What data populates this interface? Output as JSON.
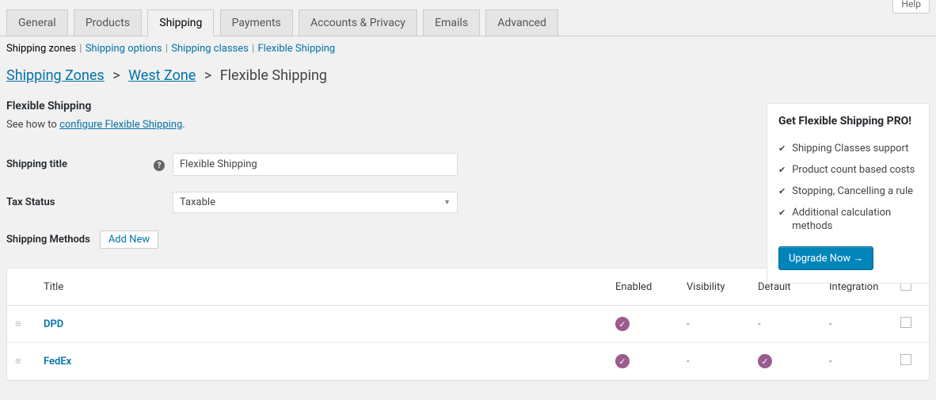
{
  "help_button": "Help",
  "tabs": [
    {
      "label": "General",
      "active": false
    },
    {
      "label": "Products",
      "active": false
    },
    {
      "label": "Shipping",
      "active": true
    },
    {
      "label": "Payments",
      "active": false
    },
    {
      "label": "Accounts & Privacy",
      "active": false
    },
    {
      "label": "Emails",
      "active": false
    },
    {
      "label": "Advanced",
      "active": false
    }
  ],
  "subtabs": {
    "current": "Shipping zones",
    "items": [
      "Shipping options",
      "Shipping classes",
      "Flexible Shipping"
    ]
  },
  "breadcrumb": {
    "items": [
      {
        "label": "Shipping Zones",
        "link": true
      },
      {
        "label": "West Zone",
        "link": true
      },
      {
        "label": "Flexible Shipping",
        "link": false
      }
    ]
  },
  "section_title": "Flexible Shipping",
  "configure": {
    "prefix": "See how to ",
    "link": "configure Flexible Shipping",
    "suffix": "."
  },
  "fields": {
    "shipping_title": {
      "label": "Shipping title",
      "value": "Flexible Shipping"
    },
    "tax_status": {
      "label": "Tax Status",
      "value": "Taxable"
    }
  },
  "methods_header": {
    "label": "Shipping Methods",
    "add_new": "Add New"
  },
  "table": {
    "headers": {
      "title": "Title",
      "enabled": "Enabled",
      "visibility": "Visibility",
      "default": "Default",
      "integration": "Integration"
    },
    "rows": [
      {
        "title": "DPD",
        "enabled": true,
        "visibility": "-",
        "default": false,
        "integration": "-"
      },
      {
        "title": "FedEx",
        "enabled": true,
        "visibility": "-",
        "default": true,
        "integration": "-"
      }
    ]
  },
  "sidebar": {
    "title": "Get Flexible Shipping PRO!",
    "features": [
      "Shipping Classes support",
      "Product count based costs",
      "Stopping, Cancelling a rule",
      "Additional calculation methods"
    ],
    "cta": "Upgrade Now →"
  }
}
